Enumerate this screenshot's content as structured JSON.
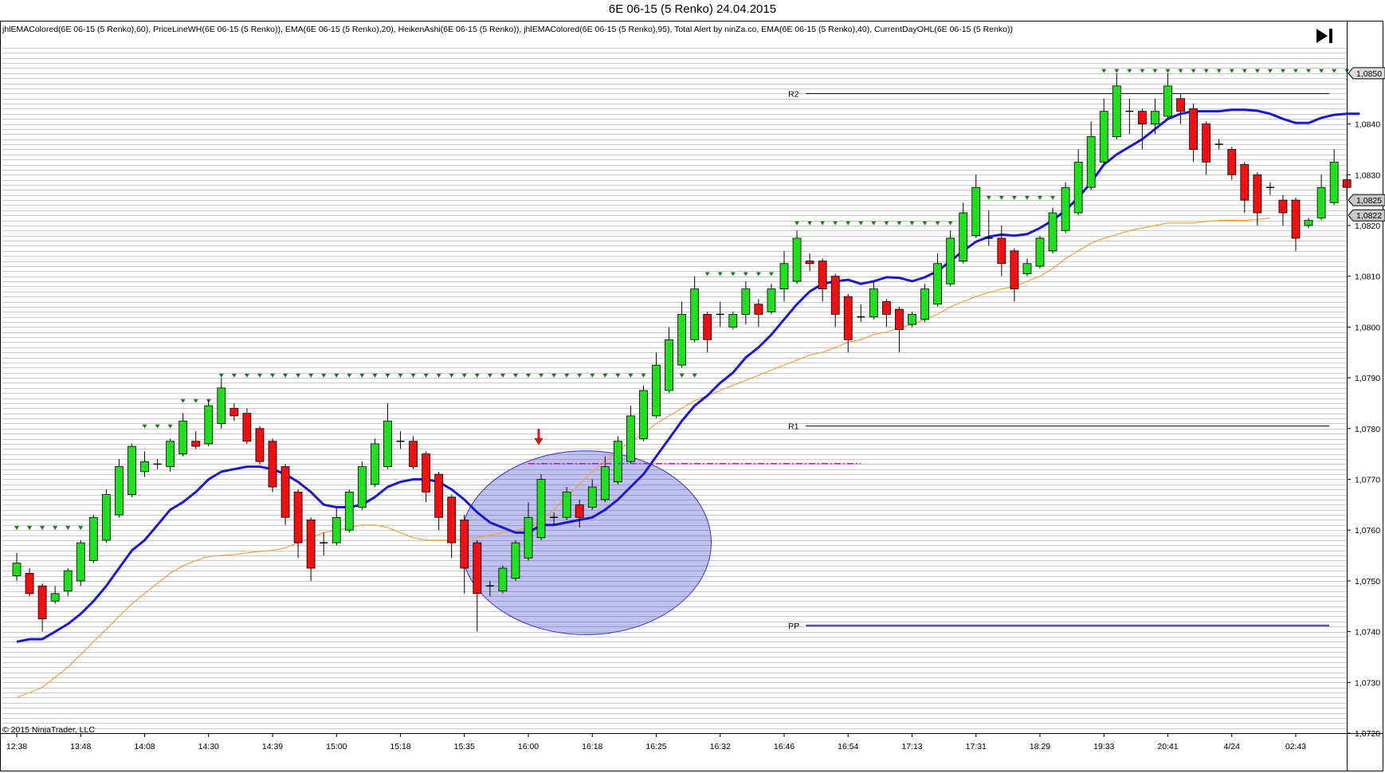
{
  "title": "6E 06-15 (5 Renko)  24.04.2015",
  "indicators_text": "jhlEMAColored(6E 06-15 (5 Renko),60), PriceLineWH(6E 06-15 (5 Renko)), EMA(6E 06-15 (5 Renko),20), HeikenAshi(6E 06-15 (5 Renko)), jhlEMAColored(6E 06-15 (5 Renko),95), Total Alert by ninZa.co, EMA(6E 06-15 (5 Renko),40), CurrentDayOHL(6E 06-15 (5 Renko))",
  "copyright": "© 2015 NinjaTrader, LLC",
  "colors": {
    "up": "#22dd22",
    "down": "#ee1111",
    "ema20": "#1a1acc",
    "ema40": "#f0a040",
    "pivot": "#5555bb",
    "marker": "#1e7a1e",
    "magenta": "#ee00ee",
    "ellipse": "#3333cc",
    "grid": "#c8c8c8"
  },
  "chart_data": {
    "type": "candlestick",
    "ylim": [
      1.072,
      1.0855
    ],
    "y_ticks": [
      "1,0720",
      "1,0730",
      "1,0740",
      "1,0750",
      "1,0760",
      "1,0770",
      "1,0780",
      "1,0790",
      "1,0800",
      "1,0810",
      "1,0820",
      "1,0830",
      "1,0840",
      "1,0850"
    ],
    "x_tick_labels": [
      {
        "bar": 0,
        "label": "12:38"
      },
      {
        "bar": 5,
        "label": "13:48"
      },
      {
        "bar": 10,
        "label": "14:08"
      },
      {
        "bar": 15,
        "label": "14:30"
      },
      {
        "bar": 20,
        "label": "14:39"
      },
      {
        "bar": 25,
        "label": "15:00"
      },
      {
        "bar": 30,
        "label": "15:18"
      },
      {
        "bar": 35,
        "label": "15:35"
      },
      {
        "bar": 40,
        "label": "16:00"
      },
      {
        "bar": 45,
        "label": "16:18"
      },
      {
        "bar": 50,
        "label": "16:25"
      },
      {
        "bar": 55,
        "label": "16:32"
      },
      {
        "bar": 60,
        "label": "16:46"
      },
      {
        "bar": 65,
        "label": "16:54"
      },
      {
        "bar": 70,
        "label": "17:13"
      },
      {
        "bar": 75,
        "label": "17:31"
      },
      {
        "bar": 80,
        "label": "18:29"
      },
      {
        "bar": 85,
        "label": "19:33"
      },
      {
        "bar": 90,
        "label": "20:41"
      },
      {
        "bar": 95,
        "label": "4/24"
      },
      {
        "bar": 100,
        "label": "02:43"
      }
    ],
    "candles": [
      {
        "o": 1.0751,
        "c": 1.07535,
        "h": 1.07555,
        "l": 1.075
      },
      {
        "o": 1.07515,
        "c": 1.07475,
        "h": 1.07525,
        "l": 1.0747
      },
      {
        "o": 1.0749,
        "c": 1.07425,
        "h": 1.07495,
        "l": 1.074
      },
      {
        "o": 1.0746,
        "c": 1.07475,
        "h": 1.0749,
        "l": 1.07455
      },
      {
        "o": 1.0748,
        "c": 1.0752,
        "h": 1.07525,
        "l": 1.0747
      },
      {
        "o": 1.075,
        "c": 1.07575,
        "h": 1.0758,
        "l": 1.0749
      },
      {
        "o": 1.0754,
        "c": 1.07625,
        "h": 1.0763,
        "l": 1.07535
      },
      {
        "o": 1.0758,
        "c": 1.0767,
        "h": 1.0768,
        "l": 1.07575
      },
      {
        "o": 1.0763,
        "c": 1.07725,
        "h": 1.0774,
        "l": 1.07625
      },
      {
        "o": 1.0767,
        "c": 1.07765,
        "h": 1.0777,
        "l": 1.07665
      },
      {
        "o": 1.07715,
        "c": 1.07735,
        "h": 1.07755,
        "l": 1.07705
      },
      {
        "o": 1.0773,
        "c": 1.0773,
        "h": 1.0774,
        "l": 1.0772
      },
      {
        "o": 1.07725,
        "c": 1.07775,
        "h": 1.0778,
        "l": 1.07715
      },
      {
        "o": 1.0775,
        "c": 1.07815,
        "h": 1.0783,
        "l": 1.07745
      },
      {
        "o": 1.07775,
        "c": 1.07765,
        "h": 1.07795,
        "l": 1.0776
      },
      {
        "o": 1.0777,
        "c": 1.07845,
        "h": 1.07855,
        "l": 1.07765
      },
      {
        "o": 1.0781,
        "c": 1.0788,
        "h": 1.079,
        "l": 1.078
      },
      {
        "o": 1.0784,
        "c": 1.07825,
        "h": 1.0785,
        "l": 1.07815
      },
      {
        "o": 1.0783,
        "c": 1.07775,
        "h": 1.0784,
        "l": 1.0777
      },
      {
        "o": 1.078,
        "c": 1.07735,
        "h": 1.07805,
        "l": 1.0773
      },
      {
        "o": 1.07775,
        "c": 1.07685,
        "h": 1.0778,
        "l": 1.07675
      },
      {
        "o": 1.07725,
        "c": 1.07625,
        "h": 1.0773,
        "l": 1.0761
      },
      {
        "o": 1.07675,
        "c": 1.07575,
        "h": 1.0768,
        "l": 1.07545
      },
      {
        "o": 1.0762,
        "c": 1.07525,
        "h": 1.07625,
        "l": 1.075
      },
      {
        "o": 1.07575,
        "c": 1.07575,
        "h": 1.07595,
        "l": 1.0755
      },
      {
        "o": 1.07575,
        "c": 1.07625,
        "h": 1.07645,
        "l": 1.0757
      },
      {
        "o": 1.076,
        "c": 1.07675,
        "h": 1.0768,
        "l": 1.07595
      },
      {
        "o": 1.07645,
        "c": 1.07725,
        "h": 1.07735,
        "l": 1.0764
      },
      {
        "o": 1.0769,
        "c": 1.0777,
        "h": 1.0778,
        "l": 1.07685
      },
      {
        "o": 1.07725,
        "c": 1.07815,
        "h": 1.0785,
        "l": 1.0772
      },
      {
        "o": 1.07775,
        "c": 1.07775,
        "h": 1.07795,
        "l": 1.0776
      },
      {
        "o": 1.07775,
        "c": 1.07725,
        "h": 1.07785,
        "l": 1.0772
      },
      {
        "o": 1.0775,
        "c": 1.07675,
        "h": 1.07755,
        "l": 1.07655
      },
      {
        "o": 1.0771,
        "c": 1.07625,
        "h": 1.07715,
        "l": 1.076
      },
      {
        "o": 1.07665,
        "c": 1.07575,
        "h": 1.0767,
        "l": 1.07545
      },
      {
        "o": 1.0762,
        "c": 1.07525,
        "h": 1.0763,
        "l": 1.07475
      },
      {
        "o": 1.07575,
        "c": 1.07475,
        "h": 1.0758,
        "l": 1.074
      },
      {
        "o": 1.0749,
        "c": 1.0749,
        "h": 1.075,
        "l": 1.0747
      },
      {
        "o": 1.0748,
        "c": 1.07525,
        "h": 1.0753,
        "l": 1.07475
      },
      {
        "o": 1.07505,
        "c": 1.07575,
        "h": 1.0758,
        "l": 1.075
      },
      {
        "o": 1.07545,
        "c": 1.07625,
        "h": 1.07655,
        "l": 1.0754
      },
      {
        "o": 1.07585,
        "c": 1.077,
        "h": 1.0771,
        "l": 1.0758
      },
      {
        "o": 1.07625,
        "c": 1.07625,
        "h": 1.07635,
        "l": 1.0761
      },
      {
        "o": 1.07625,
        "c": 1.07675,
        "h": 1.07685,
        "l": 1.0762
      },
      {
        "o": 1.0765,
        "c": 1.07625,
        "h": 1.0766,
        "l": 1.07605
      },
      {
        "o": 1.07645,
        "c": 1.07685,
        "h": 1.077,
        "l": 1.0764
      },
      {
        "o": 1.0766,
        "c": 1.07725,
        "h": 1.07745,
        "l": 1.07655
      },
      {
        "o": 1.07695,
        "c": 1.07775,
        "h": 1.07785,
        "l": 1.0769
      },
      {
        "o": 1.07735,
        "c": 1.07825,
        "h": 1.07845,
        "l": 1.0773
      },
      {
        "o": 1.0778,
        "c": 1.07875,
        "h": 1.07885,
        "l": 1.07775
      },
      {
        "o": 1.07825,
        "c": 1.07925,
        "h": 1.0795,
        "l": 1.0782
      },
      {
        "o": 1.07875,
        "c": 1.07975,
        "h": 1.08,
        "l": 1.0787
      },
      {
        "o": 1.07925,
        "c": 1.08025,
        "h": 1.0805,
        "l": 1.0792
      },
      {
        "o": 1.07975,
        "c": 1.08075,
        "h": 1.081,
        "l": 1.0797
      },
      {
        "o": 1.08025,
        "c": 1.07975,
        "h": 1.0803,
        "l": 1.0795
      },
      {
        "o": 1.08025,
        "c": 1.08025,
        "h": 1.0805,
        "l": 1.08
      },
      {
        "o": 1.08,
        "c": 1.08025,
        "h": 1.0803,
        "l": 1.07995
      },
      {
        "o": 1.08025,
        "c": 1.08075,
        "h": 1.0809,
        "l": 1.08005
      },
      {
        "o": 1.08045,
        "c": 1.08025,
        "h": 1.08055,
        "l": 1.08
      },
      {
        "o": 1.0803,
        "c": 1.08075,
        "h": 1.08085,
        "l": 1.08025
      },
      {
        "o": 1.08075,
        "c": 1.08125,
        "h": 1.0815,
        "l": 1.0805
      },
      {
        "o": 1.0809,
        "c": 1.08175,
        "h": 1.0819,
        "l": 1.08085
      },
      {
        "o": 1.0813,
        "c": 1.08125,
        "h": 1.08145,
        "l": 1.0811
      },
      {
        "o": 1.0813,
        "c": 1.08075,
        "h": 1.08135,
        "l": 1.0805
      },
      {
        "o": 1.081,
        "c": 1.08025,
        "h": 1.08105,
        "l": 1.08
      },
      {
        "o": 1.0806,
        "c": 1.07975,
        "h": 1.08065,
        "l": 1.0795
      },
      {
        "o": 1.0802,
        "c": 1.0802,
        "h": 1.08045,
        "l": 1.0801
      },
      {
        "o": 1.0802,
        "c": 1.08075,
        "h": 1.0809,
        "l": 1.08015
      },
      {
        "o": 1.0805,
        "c": 1.08025,
        "h": 1.08055,
        "l": 1.08
      },
      {
        "o": 1.08035,
        "c": 1.07995,
        "h": 1.0804,
        "l": 1.0795
      },
      {
        "o": 1.08005,
        "c": 1.08025,
        "h": 1.0803,
        "l": 1.08
      },
      {
        "o": 1.08015,
        "c": 1.08075,
        "h": 1.08085,
        "l": 1.0801
      },
      {
        "o": 1.08045,
        "c": 1.08125,
        "h": 1.08145,
        "l": 1.0804
      },
      {
        "o": 1.08085,
        "c": 1.08175,
        "h": 1.0819,
        "l": 1.0808
      },
      {
        "o": 1.0813,
        "c": 1.08225,
        "h": 1.08245,
        "l": 1.08125
      },
      {
        "o": 1.0818,
        "c": 1.08275,
        "h": 1.083,
        "l": 1.08175
      },
      {
        "o": 1.08175,
        "c": 1.08175,
        "h": 1.0823,
        "l": 1.0816
      },
      {
        "o": 1.08175,
        "c": 1.08125,
        "h": 1.082,
        "l": 1.081
      },
      {
        "o": 1.0815,
        "c": 1.08075,
        "h": 1.08155,
        "l": 1.0805
      },
      {
        "o": 1.08105,
        "c": 1.08125,
        "h": 1.08135,
        "l": 1.081
      },
      {
        "o": 1.0812,
        "c": 1.08175,
        "h": 1.0818,
        "l": 1.08115
      },
      {
        "o": 1.0815,
        "c": 1.08225,
        "h": 1.08235,
        "l": 1.08145
      },
      {
        "o": 1.0819,
        "c": 1.08275,
        "h": 1.08285,
        "l": 1.08185
      },
      {
        "o": 1.08225,
        "c": 1.08325,
        "h": 1.0835,
        "l": 1.0822
      },
      {
        "o": 1.08275,
        "c": 1.08375,
        "h": 1.08405,
        "l": 1.0827
      },
      {
        "o": 1.08325,
        "c": 1.08425,
        "h": 1.0845,
        "l": 1.0832
      },
      {
        "o": 1.08375,
        "c": 1.08475,
        "h": 1.085,
        "l": 1.0837
      },
      {
        "o": 1.08425,
        "c": 1.08425,
        "h": 1.0845,
        "l": 1.0838
      },
      {
        "o": 1.08425,
        "c": 1.084,
        "h": 1.0843,
        "l": 1.0835
      },
      {
        "o": 1.084,
        "c": 1.08425,
        "h": 1.0845,
        "l": 1.0838
      },
      {
        "o": 1.08415,
        "c": 1.08475,
        "h": 1.085,
        "l": 1.0841
      },
      {
        "o": 1.0845,
        "c": 1.08425,
        "h": 1.0846,
        "l": 1.084
      },
      {
        "o": 1.0843,
        "c": 1.0835,
        "h": 1.0844,
        "l": 1.08325
      },
      {
        "o": 1.084,
        "c": 1.08325,
        "h": 1.08405,
        "l": 1.083
      },
      {
        "o": 1.0836,
        "c": 1.0836,
        "h": 1.0837,
        "l": 1.0835
      },
      {
        "o": 1.0835,
        "c": 1.083,
        "h": 1.08355,
        "l": 1.0829
      },
      {
        "o": 1.0832,
        "c": 1.0825,
        "h": 1.08325,
        "l": 1.08225
      },
      {
        "o": 1.083,
        "c": 1.08225,
        "h": 1.08305,
        "l": 1.082
      },
      {
        "o": 1.08275,
        "c": 1.08275,
        "h": 1.08285,
        "l": 1.0826
      },
      {
        "o": 1.0825,
        "c": 1.08225,
        "h": 1.0826,
        "l": 1.082
      },
      {
        "o": 1.0825,
        "c": 1.08175,
        "h": 1.08255,
        "l": 1.0815
      },
      {
        "o": 1.082,
        "c": 1.0821,
        "h": 1.08215,
        "l": 1.08195
      },
      {
        "o": 1.08215,
        "c": 1.08275,
        "h": 1.083,
        "l": 1.0821
      },
      {
        "o": 1.08245,
        "c": 1.08325,
        "h": 1.0835,
        "l": 1.0824
      },
      {
        "o": 1.0829,
        "c": 1.08275,
        "h": 1.083,
        "l": 1.0825
      }
    ],
    "ema20": [
      1.0738,
      1.07385,
      1.07385,
      1.074,
      1.07415,
      1.07435,
      1.0746,
      1.0749,
      1.07525,
      1.0756,
      1.0758,
      1.0761,
      1.0764,
      1.07655,
      1.07675,
      1.077,
      1.07715,
      1.0772,
      1.07725,
      1.07725,
      1.0772,
      1.0771,
      1.07695,
      1.07675,
      1.0765,
      1.07645,
      1.07645,
      1.0765,
      1.07665,
      1.07685,
      1.07695,
      1.077,
      1.077,
      1.07695,
      1.0768,
      1.0766,
      1.07635,
      1.07615,
      1.07605,
      1.07595,
      1.07595,
      1.0761,
      1.0761,
      1.07615,
      1.0762,
      1.07625,
      1.0764,
      1.0766,
      1.07685,
      1.0771,
      1.07745,
      1.0778,
      1.07815,
      1.07845,
      1.07865,
      1.0789,
      1.0791,
      1.0794,
      1.0796,
      1.07985,
      1.08015,
      1.08045,
      1.0807,
      1.08085,
      1.0809,
      1.08093,
      1.08085,
      1.0809,
      1.08098,
      1.08097,
      1.0809,
      1.08098,
      1.0811,
      1.0813,
      1.0815,
      1.08168,
      1.08178,
      1.08182,
      1.0818,
      1.08183,
      1.08195,
      1.0821,
      1.0823,
      1.08255,
      1.08285,
      1.0832,
      1.0834,
      1.08355,
      1.0837,
      1.0839,
      1.0841,
      1.0842,
      1.08425,
      1.08425,
      1.08425,
      1.08428,
      1.08428,
      1.08426,
      1.0842,
      1.0841,
      1.08402,
      1.08402,
      1.08412,
      1.08418,
      1.0842,
      1.0842
    ],
    "ema40": [
      1.0727,
      1.0728,
      1.0729,
      1.0731,
      1.0733,
      1.07355,
      1.0738,
      1.07405,
      1.0743,
      1.07455,
      1.07475,
      1.07495,
      1.07515,
      1.0753,
      1.0754,
      1.07548,
      1.0755,
      1.07552,
      1.07555,
      1.07558,
      1.0756,
      1.07565,
      1.07575,
      1.07585,
      1.07595,
      1.076,
      1.07605,
      1.0761,
      1.0761,
      1.07605,
      1.07595,
      1.07585,
      1.0758,
      1.0758,
      1.0758,
      1.07583,
      1.07585,
      1.0759,
      1.07595,
      1.076,
      1.07605,
      1.0762,
      1.0764,
      1.07665,
      1.0769,
      1.07715,
      1.07735,
      1.07755,
      1.07775,
      1.0779,
      1.0781,
      1.07825,
      1.0784,
      1.07855,
      1.07865,
      1.07875,
      1.07885,
      1.07895,
      1.07905,
      1.07915,
      1.07925,
      1.07935,
      1.07945,
      1.0795,
      1.0796,
      1.0797,
      1.07975,
      1.07985,
      1.0799,
      1.07998,
      1.08005,
      1.08015,
      1.08025,
      1.0804,
      1.0805,
      1.0806,
      1.08068,
      1.08075,
      1.0808,
      1.0809,
      1.081,
      1.08115,
      1.08135,
      1.0815,
      1.08165,
      1.08175,
      1.08182,
      1.0819,
      1.08195,
      1.082,
      1.08205,
      1.08205,
      1.08205,
      1.08208,
      1.0821,
      1.0821,
      1.0821,
      1.08212,
      1.08215
    ],
    "ema40_start_bar": 0,
    "stop_markers": [
      {
        "y": 1.07605,
        "from": 0,
        "to": 6
      },
      {
        "y": 1.07805,
        "from": 10,
        "to": 12
      },
      {
        "y": 1.07855,
        "from": 13,
        "to": 15
      },
      {
        "y": 1.07905,
        "from": 16,
        "to": 53
      },
      {
        "y": 1.08105,
        "from": 54,
        "to": 59
      },
      {
        "y": 1.08205,
        "from": 61,
        "to": 74
      },
      {
        "y": 1.08255,
        "from": 75,
        "to": 82
      },
      {
        "y": 1.08505,
        "from": 85,
        "to": 104
      }
    ],
    "pivots": [
      {
        "label": "R2",
        "y": 1.0846,
        "from_bar": 62
      },
      {
        "label": "R1",
        "y": 1.07805,
        "from_bar": 62
      },
      {
        "label": "PP",
        "y": 1.07412,
        "from_bar": 62
      }
    ],
    "magenta_line": {
      "y": 1.07731,
      "from_bar": 40,
      "to_bar": 66
    },
    "arrow": {
      "bar": 40,
      "y": 1.07765
    },
    "ellipse": {
      "cx_bar": 44.5,
      "cy": 1.07575,
      "rx_bars": 9.8,
      "ry": 0.00181
    },
    "price_flags": [
      {
        "label": "1,0850",
        "y": 1.085,
        "fill": "#dddddd"
      },
      {
        "label": "1,0825",
        "y": 1.0825,
        "fill": "#c8c8c8"
      },
      {
        "label": "1,0822",
        "y": 1.0822,
        "fill": "#c8c8c8"
      }
    ]
  }
}
